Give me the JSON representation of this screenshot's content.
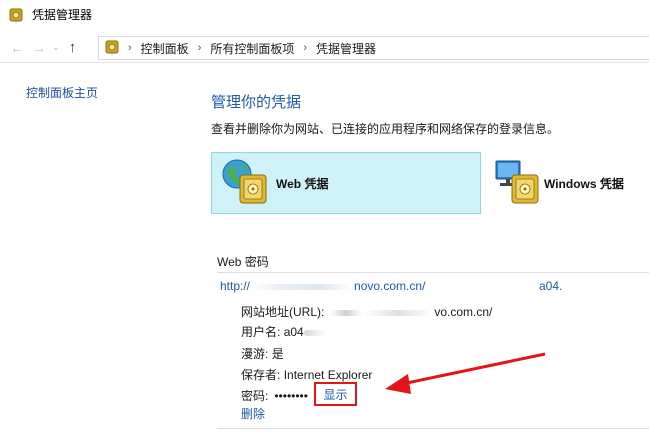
{
  "window": {
    "title": "凭据管理器"
  },
  "nav": {
    "back_icon": "back-arrow-icon",
    "forward_icon": "forward-arrow-icon",
    "up_icon": "up-arrow-icon",
    "breadcrumbs": [
      "控制面板",
      "所有控制面板项",
      "凭据管理器"
    ]
  },
  "sidebar": {
    "home_link": "控制面板主页"
  },
  "main": {
    "title": "管理你的凭据",
    "description": "查看并删除你为网站、已连接的应用程序和网络保存的登录信息。",
    "tiles": [
      {
        "label": "Web 凭据",
        "selected": true
      },
      {
        "label": "Windows 凭据",
        "selected": false
      }
    ]
  },
  "web_passwords": {
    "heading": "Web 密码",
    "entry": {
      "url_prefix": "http://",
      "url_suffix": "novo.com.cn/",
      "user_short": "a04.",
      "site_label": "网站地址(URL):",
      "site_value_suffix": "vo.com.cn/",
      "user_label": "用户名:",
      "user_value": "a04",
      "roaming_label": "漫游:",
      "roaming_value": "是",
      "saved_by_label": "保存者:",
      "saved_by_value": "Internet Explorer",
      "password_label": "密码:",
      "password_value": "••••••••",
      "show_link": "显示",
      "delete_link": "删除"
    }
  },
  "colors": {
    "accent_blue": "#1e5aa8",
    "tile_selected_bg": "#cff2f8",
    "tile_selected_border": "#8fd6e6",
    "highlight_red": "#e3151b"
  }
}
